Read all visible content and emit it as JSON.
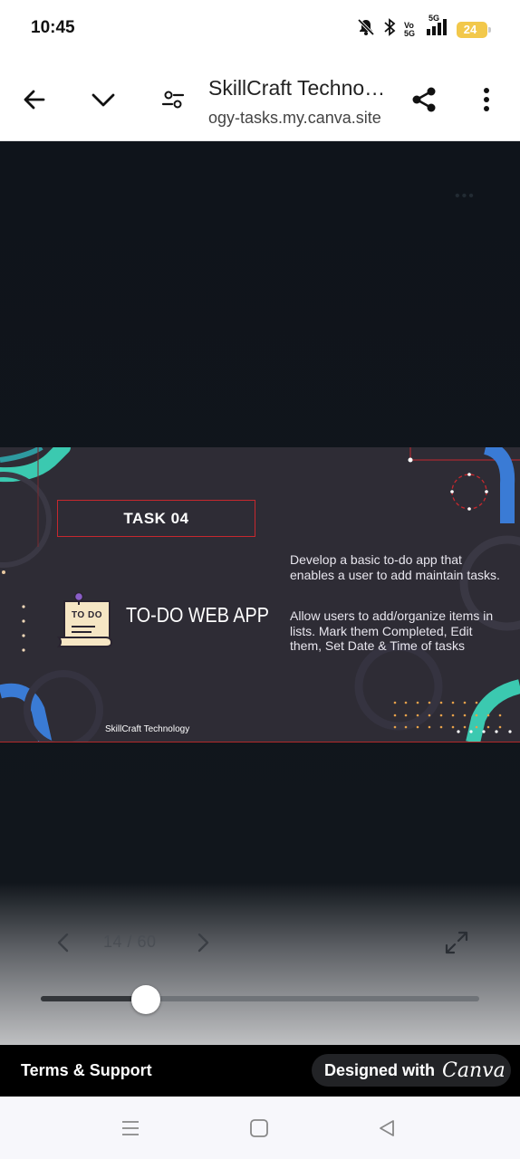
{
  "status_bar": {
    "time": "10:45",
    "battery_level": "24",
    "network": "5G",
    "volte": "Vo 5G"
  },
  "toolbar": {
    "title": "SkillCraft Techno…",
    "url": "ogy-tasks.my.canva.site"
  },
  "slide": {
    "task_label": "TASK 04",
    "app_title": "TO-DO WEB APP",
    "todo_badge": "TO DO",
    "description_1": "Develop a basic to-do app that enables a user to add maintain tasks.",
    "description_2": "Allow users to add/organize items in lists. Mark them Completed, Edit them, Set Date & Time of tasks",
    "brand": "SkillCraft Technology"
  },
  "viewer": {
    "current_page": 14,
    "total_pages": 60,
    "page_indicator": "14 / 60",
    "progress_fraction": 0.24,
    "slider_value_fraction": 0.24
  },
  "footer": {
    "terms_label": "Terms & Support",
    "designed_label": "Designed with",
    "brand_logo_text": "Canva"
  },
  "icons": {
    "back": "back-arrow-icon",
    "collapse": "chevron-down-icon",
    "settings": "tune-icon",
    "share": "share-icon",
    "menu": "more-vert-icon",
    "prev": "chevron-left-icon",
    "next": "chevron-right-icon",
    "fullscreen": "fullscreen-icon"
  },
  "colors": {
    "slide_bg": "#2e2c35",
    "accent_red": "#c6282e",
    "accent_teal": "#3bc9b0",
    "accent_blue": "#3a7bd5",
    "dot_orange": "#e8a24a"
  }
}
